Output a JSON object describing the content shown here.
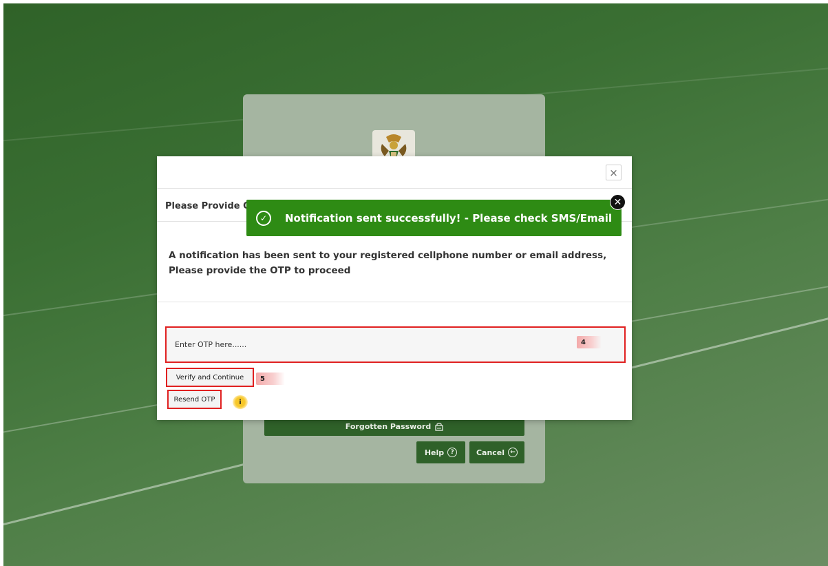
{
  "login": {
    "forgotten_password_label": "Forgotten Password",
    "help_label": "Help",
    "cancel_label": "Cancel",
    "logo_icon": "coat-of-arms-icon",
    "lock_icon": "lock-icon",
    "help_icon": "question-circle-icon",
    "cancel_icon": "arrow-left-circle-icon"
  },
  "modal": {
    "title": "Please Provide OTP",
    "close_icon": "×",
    "message": "A notification has been sent to your registered cellphone number or email address, Please provide the OTP to proceed",
    "otp_placeholder": "Enter OTP here......",
    "otp_value": "",
    "verify_label": "Verify and Continue",
    "resend_label": "Resend OTP"
  },
  "annotations": {
    "otp_marker": "4",
    "verify_marker": "5",
    "resend_marker": "i"
  },
  "toast": {
    "message": "Notification sent successfully! - Please check SMS/Email",
    "check_icon": "✓",
    "close_icon": "✕"
  },
  "colors": {
    "primary_green": "#2f6129",
    "toast_green": "#2e8b14",
    "highlight_red": "#e02020"
  }
}
